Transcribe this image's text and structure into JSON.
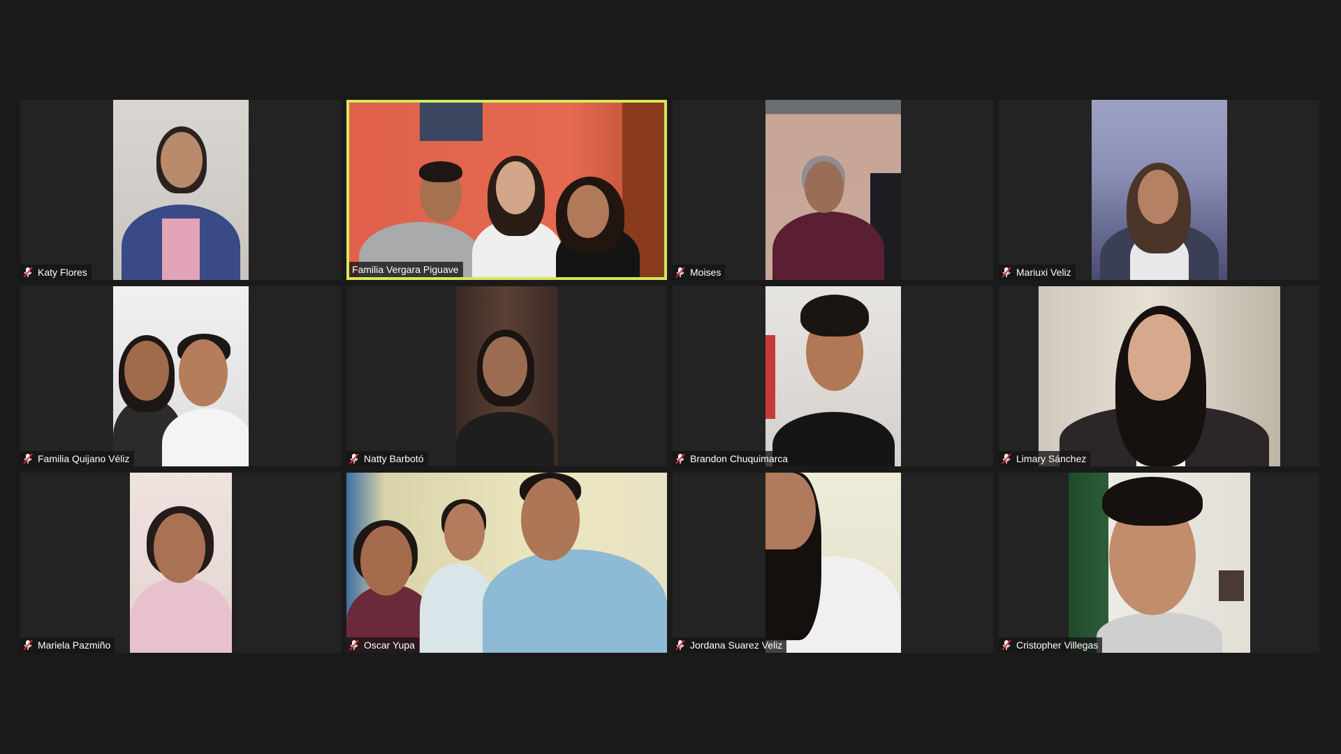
{
  "meeting": {
    "view": "gallery",
    "active_speaker_color": "#d6e85a",
    "muted_icon_color": "#e0252c",
    "participants": [
      {
        "name": "Katy Flores",
        "muted": true,
        "active": false,
        "icon": "muted-mic-icon"
      },
      {
        "name": "Familia Vergara Piguave",
        "muted": false,
        "active": true,
        "icon": null
      },
      {
        "name": "Moises",
        "muted": true,
        "active": false,
        "icon": "muted-mic-icon"
      },
      {
        "name": "Mariuxi Veliz",
        "muted": true,
        "active": false,
        "icon": "muted-mic-icon"
      },
      {
        "name": "Familia Quijano Véliz",
        "muted": true,
        "active": false,
        "icon": "muted-mic-icon"
      },
      {
        "name": "Natty Barbotó",
        "muted": true,
        "active": false,
        "icon": "muted-mic-icon"
      },
      {
        "name": "Brandon Chuquimarca",
        "muted": true,
        "active": false,
        "icon": "muted-mic-icon"
      },
      {
        "name": "Limary Sánchez",
        "muted": true,
        "active": false,
        "icon": "muted-mic-icon"
      },
      {
        "name": "Mariela Pazmiño",
        "muted": true,
        "active": false,
        "icon": "muted-mic-icon"
      },
      {
        "name": "Oscar Yupa",
        "muted": true,
        "active": false,
        "icon": "muted-mic-icon"
      },
      {
        "name": "Jordana  Suarez Veliz",
        "muted": true,
        "active": false,
        "icon": "muted-mic-icon"
      },
      {
        "name": "Cristopher Villegas",
        "muted": true,
        "active": false,
        "icon": "muted-mic-icon"
      }
    ]
  }
}
